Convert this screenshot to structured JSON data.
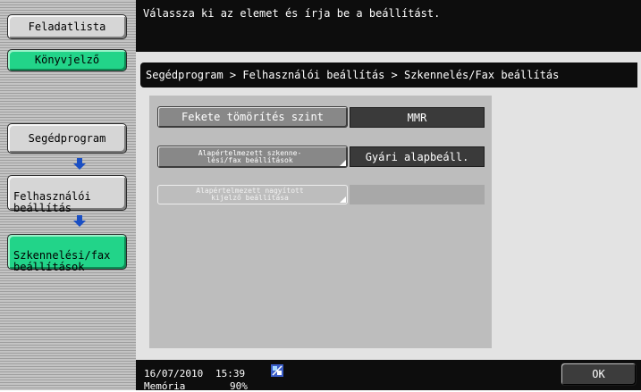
{
  "header": {
    "message": "Válassza ki az elemet és írja be a beállítást."
  },
  "sidebar": {
    "job_list_label": "Feladatlista",
    "bookmark_label": "Könyvjelző",
    "path": [
      {
        "label": "Segédprogram"
      },
      {
        "label": "Felhasználói\nbeállítás"
      },
      {
        "label": "Szkennelési/fax\nbeállítások"
      }
    ]
  },
  "breadcrumb": "Segédprogram > Felhasználói beállítás > Szkennelés/Fax beállítás",
  "settings": [
    {
      "label": "Fekete tömörítés szint",
      "value": "MMR",
      "enabled": true
    },
    {
      "label": "Alapértelmezett szkenne-\nlési/fax beállítások",
      "value": "Gyári alapbeáll.",
      "enabled": true
    },
    {
      "label": "Alapértelmezett nagyított\nkijelző beállítása",
      "value": "",
      "enabled": false
    }
  ],
  "footer": {
    "date": "16/07/2010",
    "time": "15:39",
    "memory_label": "Memória",
    "memory_value": "90%",
    "network_icon": "network-status-icon",
    "ok_label": "OK"
  },
  "colors": {
    "green": "#22d489",
    "arrow_blue": "#1a4fc4"
  }
}
